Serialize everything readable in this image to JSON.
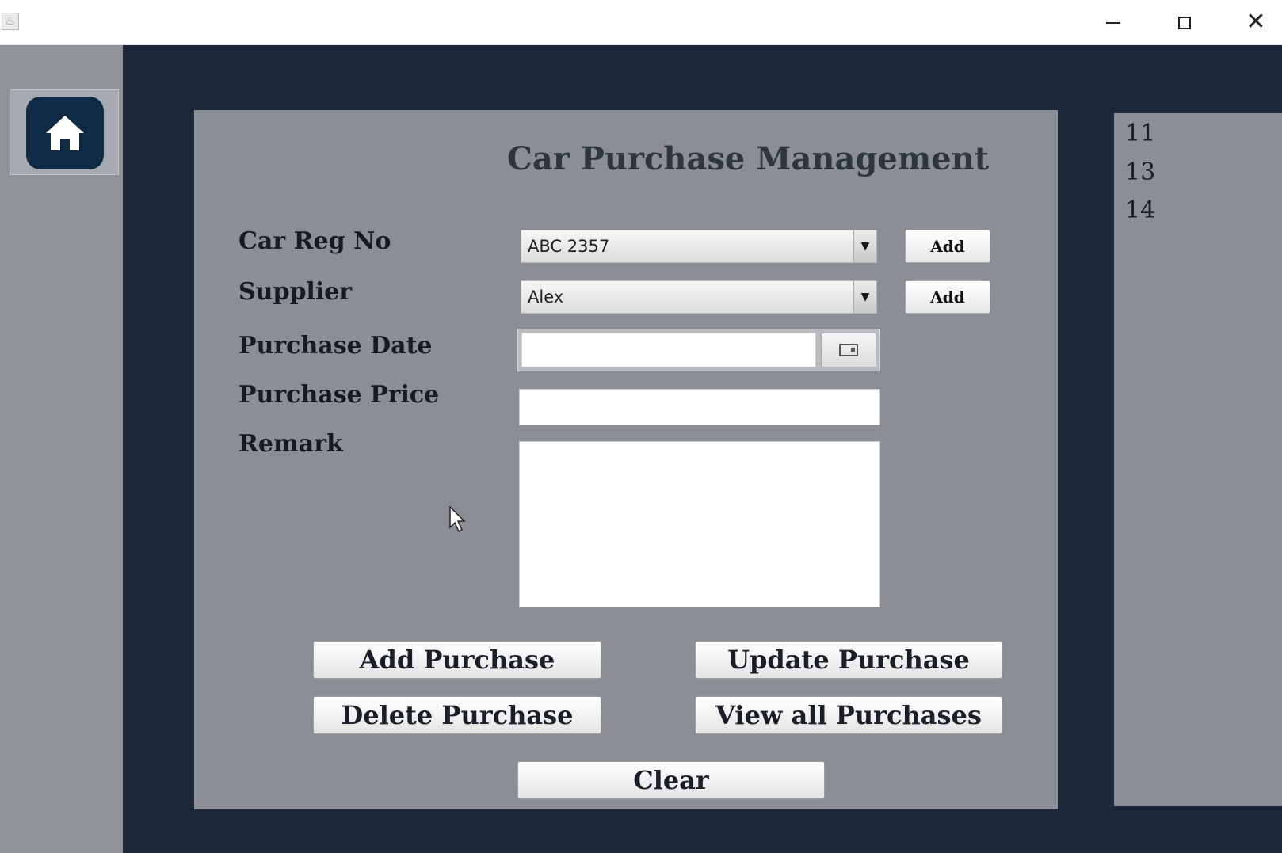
{
  "window": {
    "close_glyph": "✕"
  },
  "sidebar": {
    "home_icon": "home-icon"
  },
  "form": {
    "title": "Car Purchase Management",
    "car_reg_label": "Car Reg No",
    "car_reg_value": "ABC 2357",
    "car_reg_add_label": "Add",
    "supplier_label": "Supplier",
    "supplier_value": "Alex",
    "supplier_add_label": "Add",
    "purchase_date_label": "Purchase Date",
    "purchase_date_value": "",
    "purchase_price_label": "Purchase Price",
    "purchase_price_value": "",
    "remark_label": "Remark",
    "remark_value": "",
    "dropdown_arrow": "▼"
  },
  "actions": {
    "add_purchase": "Add Purchase",
    "update_purchase": "Update Purchase",
    "delete_purchase": "Delete Purchase",
    "view_all_purchases": "View all Purchases",
    "clear": "Clear"
  },
  "id_list": [
    "11",
    "13",
    "14"
  ]
}
